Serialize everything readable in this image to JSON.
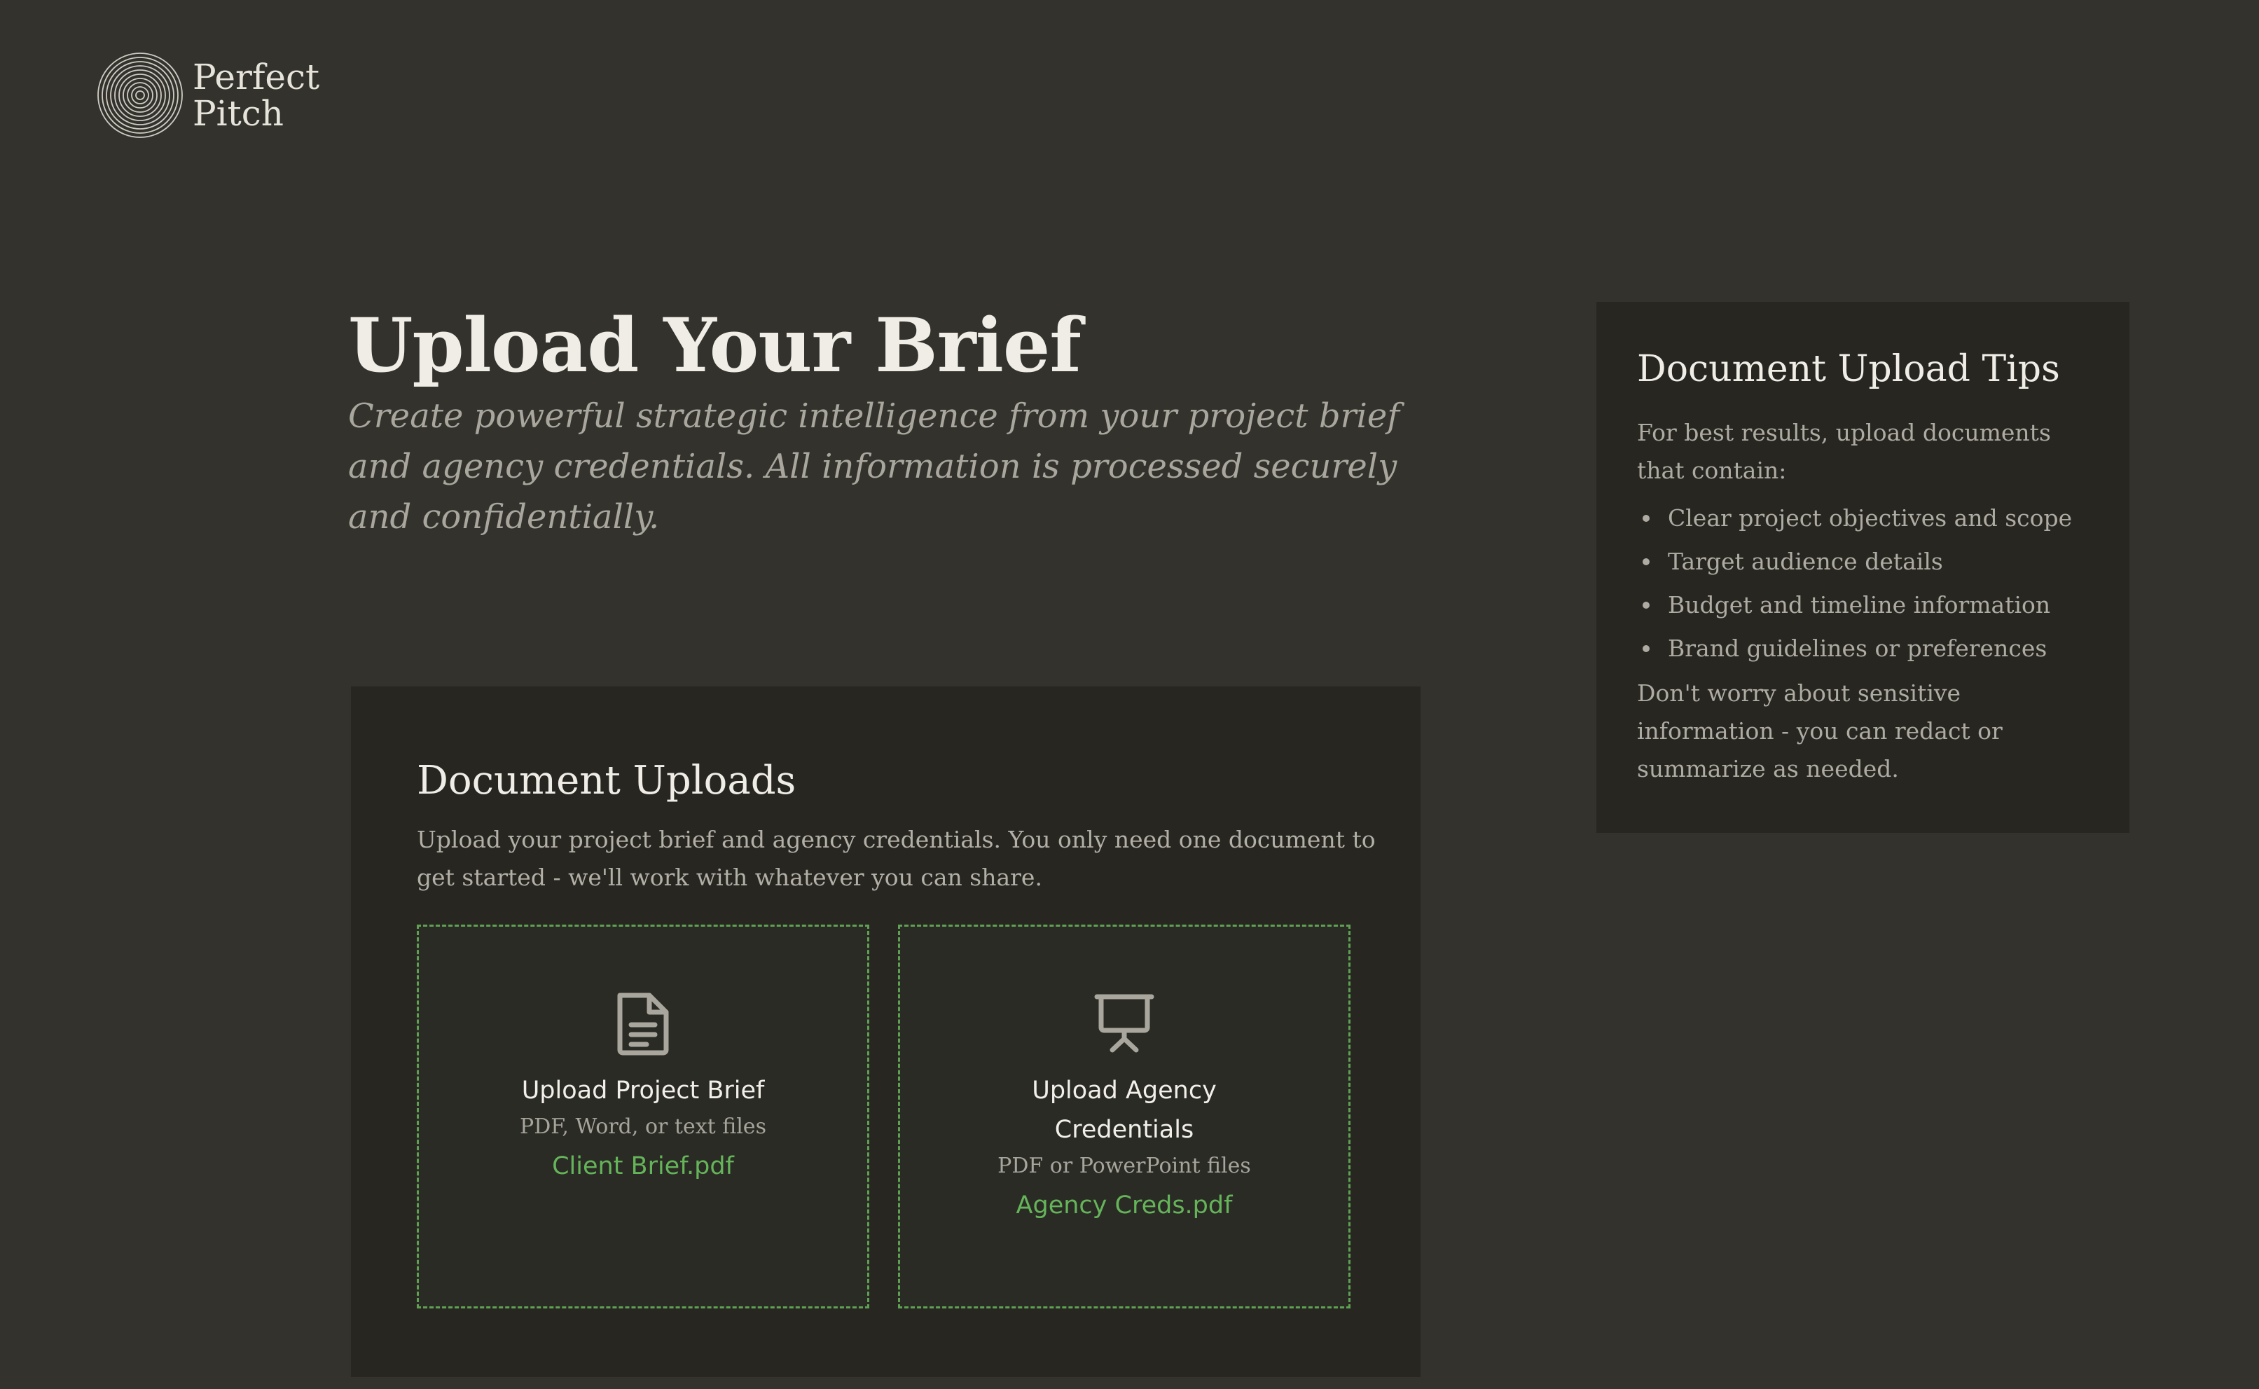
{
  "brand": {
    "name_line1": "Perfect",
    "name_line2": "Pitch"
  },
  "hero": {
    "title": "Upload Your Brief",
    "subtitle": "Create powerful strategic intelligence from your project brief and agency credentials. All information is processed securely and confidentially."
  },
  "uploads": {
    "title": "Document Uploads",
    "description": "Upload your project brief and agency credentials. You only need one document to get started - we'll work with whatever you can share.",
    "zones": [
      {
        "icon": "document-icon",
        "title": "Upload Project Brief",
        "formats": "PDF, Word, or text files",
        "file": "Client Brief.pdf"
      },
      {
        "icon": "presentation-icon",
        "title": "Upload Agency Credentials",
        "formats": "PDF or PowerPoint files",
        "file": "Agency Creds.pdf"
      }
    ]
  },
  "tips": {
    "title": "Document Upload Tips",
    "intro": "For best results, upload documents that contain:",
    "items": [
      "Clear project objectives and scope",
      "Target audience details",
      "Budget and timeline information",
      "Brand guidelines or preferences"
    ],
    "note": "Don't worry about sensitive information - you can redact or summarize as needed."
  },
  "colors": {
    "background": "#33322d",
    "panel": "#282621",
    "accent_green": "#65b45a",
    "dashed_border": "#5ea152"
  }
}
